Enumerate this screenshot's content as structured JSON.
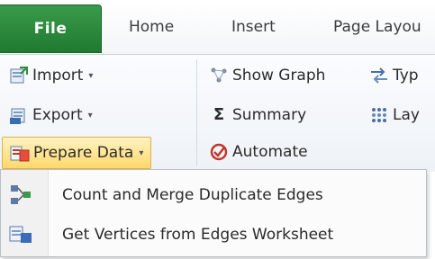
{
  "tabs": {
    "file": "File",
    "home": "Home",
    "insert": "Insert",
    "page_layout": "Page Layou"
  },
  "ribbon": {
    "import_label": "Import",
    "export_label": "Export",
    "prepare_label": "Prepare Data",
    "show_graph_label": "Show Graph",
    "summary_label": "Summary",
    "automate_label": "Automate",
    "type_label": "Typ",
    "layout_label": "Lay"
  },
  "menu": {
    "items": [
      {
        "label": "Count and Merge Duplicate Edges",
        "icon": "merge-edges-icon"
      },
      {
        "label": "Get Vertices from Edges Worksheet",
        "icon": "vertices-icon"
      }
    ]
  },
  "colors": {
    "file_tab": "#2a8a3c",
    "prepare_highlight": "#ffd86a"
  }
}
